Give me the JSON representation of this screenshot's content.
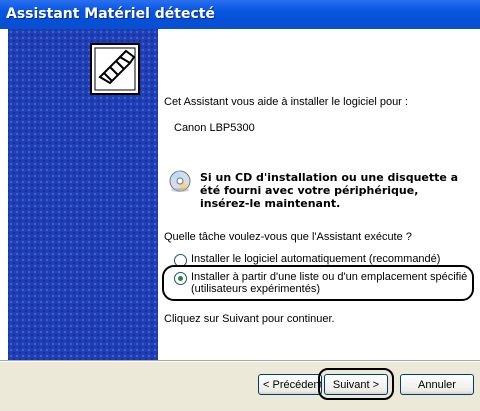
{
  "window": {
    "title": "Assistant Matériel détecté"
  },
  "icons": {
    "hardware": "hardware-wizard-icon",
    "cd": "cd-icon"
  },
  "content": {
    "intro": "Cet Assistant vous aide à installer le logiciel pour :",
    "device": "Canon LBP5300",
    "cd_note": "Si un CD d'installation ou une disquette a été fourni avec votre périphérique, insérez-le maintenant.",
    "question": "Quelle tâche voulez-vous que l'Assistant exécute ?",
    "options": [
      {
        "label": "Installer le logiciel automatiquement (recommandé)",
        "selected": false
      },
      {
        "label_line1": "Installer à partir d'une liste ou d'un emplacement spécifié",
        "label_line2": "(utilisateurs expérimentés)",
        "selected": true
      }
    ],
    "continue_text": "Cliquez sur Suivant pour continuer."
  },
  "buttons": {
    "back": "< Précédent",
    "next": "Suivant >",
    "cancel": "Annuler"
  }
}
